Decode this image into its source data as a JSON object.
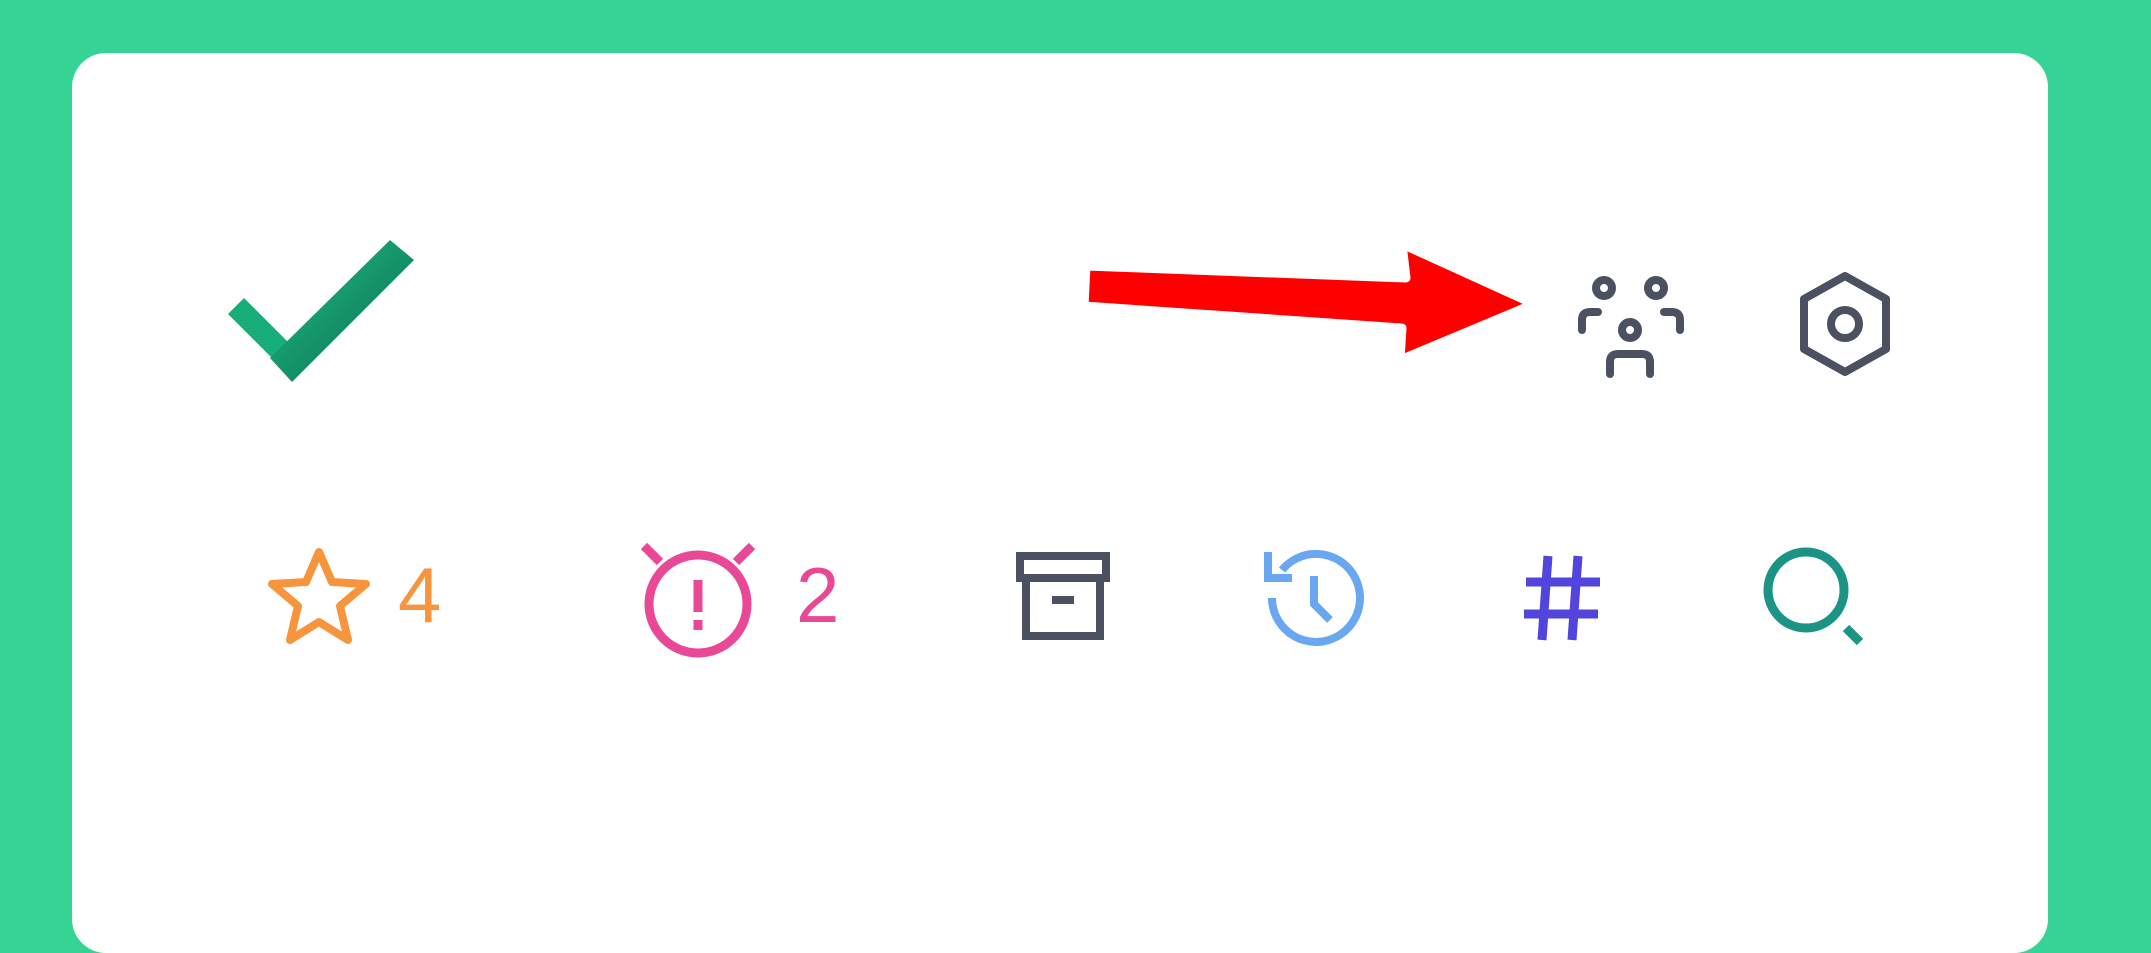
{
  "colors": {
    "background": "#36d494",
    "card": "#ffffff",
    "starred": "#f6953e",
    "reminders": "#e84896",
    "archive": "#4b5160",
    "history": "#6aa7f1",
    "hashtag": "#5145dd",
    "search": "#1b9486",
    "header_icons": "#4b5160",
    "annotation_arrow": "#ff0000"
  },
  "header": {
    "logo_icon": "checkmark-logo",
    "shared_members_icon": "people-group-icon",
    "settings_icon": "hexagon-gear-icon"
  },
  "annotation": {
    "icon": "red-arrow",
    "points_to": "people-group-icon"
  },
  "toolbar": {
    "starred": {
      "icon": "star-icon",
      "count": "4"
    },
    "reminders": {
      "icon": "alarm-clock-icon",
      "count": "2"
    },
    "archive": {
      "icon": "archive-box-icon"
    },
    "history": {
      "icon": "history-clock-icon"
    },
    "hashtags": {
      "icon": "hashtag-icon"
    },
    "search": {
      "icon": "search-icon"
    }
  }
}
